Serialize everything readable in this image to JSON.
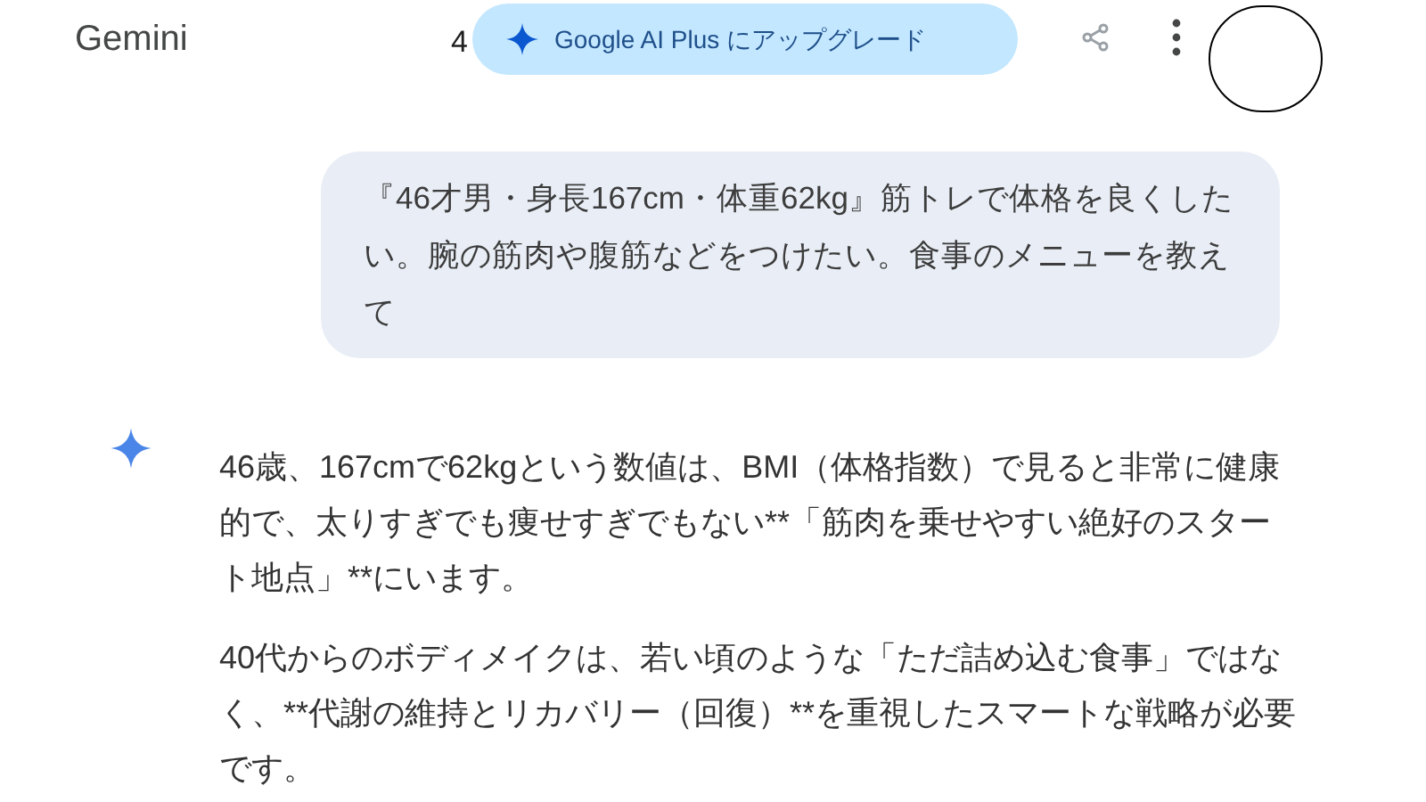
{
  "header": {
    "title": "Gemini",
    "hidden_title_fragment": "4",
    "upgrade_button": "Google AI Plus にアップグレード"
  },
  "user_message": "『46才男・身長167cm・体重62kg』筋トレで体格を良くしたい。腕の筋肉や腹筋などをつけたい。食事のメニューを教えて",
  "response": {
    "paragraphs": [
      "46歳、167cmで62kgという数値は、BMI（体格指数）で見ると非常に健康的で、太りすぎでも痩せすぎでもない**「筋肉を乗せやすい絶好のスタート地点」**にいます。",
      "40代からのボディメイクは、若い頃のような「ただ詰め込む食事」ではなく、**代謝の維持とリカバリー（回復）**を重視したスマートな戦略が必要です。"
    ]
  }
}
